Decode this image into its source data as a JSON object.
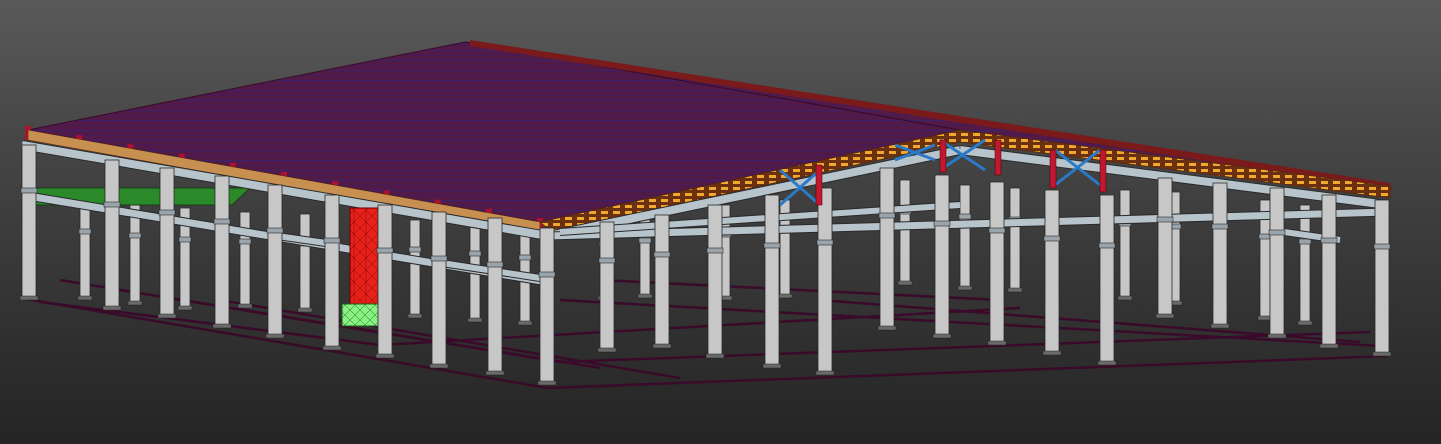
{
  "viewport": {
    "label": "",
    "background": {
      "top": "#5a5a5a",
      "bottom": "#242424"
    }
  },
  "model": {
    "kind": "3d-structural-frame",
    "render_style": "shaded-with-edges",
    "colors": {
      "roof_deck": "#5a1c4a",
      "roof_purlins": "#2a2a8c",
      "ridge_edge": "#7a1a1a",
      "column": "#c7c7c7",
      "column_edge": "#2a2a2a",
      "beam": "#b8c4cc",
      "eave_purlins": "#e8a020",
      "bracing": "#2a7ac8",
      "highlight_wall": "#e8201a",
      "highlight_base": "#80f070",
      "mezzanine_slab": "#2a8a2a",
      "foundation_lines": "#3a0a2a",
      "rafter_end": "#b01030"
    }
  }
}
